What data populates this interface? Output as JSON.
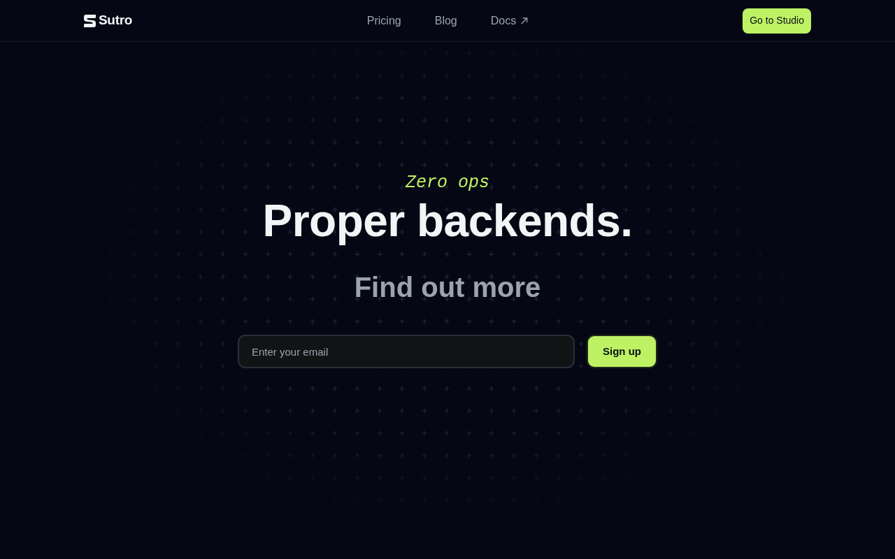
{
  "navbar": {
    "logo": {
      "text": "Sutro"
    },
    "links": [
      {
        "label": "Pricing",
        "external": false
      },
      {
        "label": "Blog",
        "external": false
      },
      {
        "label": "Docs",
        "external": true
      }
    ],
    "cta": "Go to Studio"
  },
  "hero": {
    "eyebrow": "Zero ops",
    "headline": "Proper backends.",
    "subheading": "Find out more",
    "signup": {
      "placeholder": "Enter your email",
      "button": "Sign up"
    }
  }
}
